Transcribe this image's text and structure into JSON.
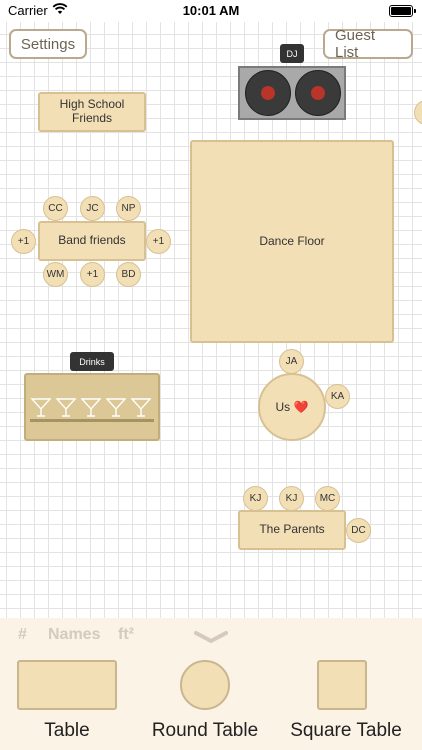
{
  "status_bar": {
    "carrier": "Carrier",
    "time": "10:01 AM"
  },
  "toolbar": {
    "settings_label": "Settings",
    "guest_list_label": "Guest List"
  },
  "floor": {
    "dj_tag": "DJ",
    "high_school_table": "High School\nFriends",
    "dance_floor": "Dance Floor",
    "band_table": "Band friends",
    "band_seats": [
      "CC",
      "JC",
      "NP",
      "+1",
      "+1",
      "WM",
      "+1",
      "BD"
    ],
    "drinks_tag": "Drinks",
    "round_table": "Us ❤️",
    "round_seats": [
      "JA",
      "KA"
    ],
    "parents_table": "The Parents",
    "parents_seats": [
      "KJ",
      "KJ",
      "MC",
      "DC"
    ]
  },
  "palette": {
    "tabs": [
      "#",
      "Names",
      "ft²"
    ],
    "items": [
      "Table",
      "Round Table",
      "Square Table"
    ]
  },
  "colors": {
    "table_fill": "#f3dfb5",
    "table_border": "#d7c193",
    "button_border": "#b9a98f",
    "accent_red": "#b9352a"
  }
}
